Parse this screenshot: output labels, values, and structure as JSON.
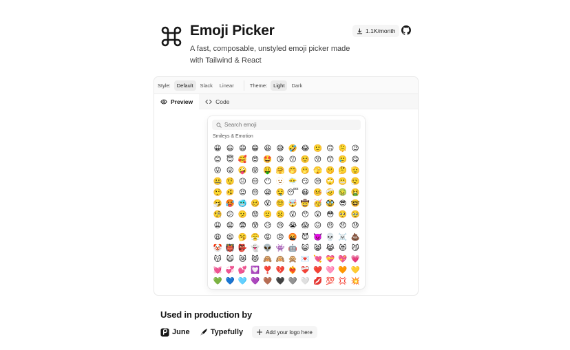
{
  "header": {
    "title": "Emoji Picker",
    "subtitle": "A fast, composable, unstyled emoji picker made with Tailwind & React",
    "downloads": "1.1K/month"
  },
  "toolbar": {
    "style_label": "Style:",
    "style_options": [
      "Default",
      "Slack",
      "Linear"
    ],
    "style_selected": "Default",
    "theme_label": "Theme:",
    "theme_options": [
      "Light",
      "Dark"
    ],
    "theme_selected": "Light"
  },
  "tabs": [
    {
      "label": "Preview",
      "icon": "eye-icon",
      "active": true
    },
    {
      "label": "Code",
      "icon": "code-icon",
      "active": false
    }
  ],
  "picker": {
    "search_placeholder": "Search emoji",
    "category": "Smileys & Emotion",
    "emojis": [
      "😀",
      "😃",
      "😄",
      "😁",
      "😆",
      "😅",
      "🤣",
      "😂",
      "🙂",
      "🙃",
      "🫠",
      "😉",
      "😊",
      "😇",
      "🥰",
      "😍",
      "🤩",
      "😘",
      "😗",
      "☺️",
      "😚",
      "😙",
      "🥲",
      "😋",
      "😛",
      "😜",
      "🤪",
      "😝",
      "🤑",
      "🤗",
      "🤭",
      "🫢",
      "🫣",
      "🤫",
      "🤔",
      "🫡",
      "🤐",
      "🤨",
      "😐",
      "😑",
      "😶",
      "🫥",
      "😶‍🌫️",
      "😏",
      "😒",
      "🙄",
      "😬",
      "😮‍💨",
      "🤥",
      "🫨",
      "😌",
      "😔",
      "😪",
      "🤤",
      "😴",
      "😷",
      "🤒",
      "🤕",
      "🤢",
      "🤮",
      "🤧",
      "🥵",
      "🥶",
      "🥴",
      "😵",
      "😵‍💫",
      "🤯",
      "🤠",
      "🥳",
      "🥸",
      "😎",
      "🤓",
      "🧐",
      "😕",
      "🫤",
      "😟",
      "🙁",
      "☹️",
      "😮",
      "😯",
      "😲",
      "😳",
      "🥺",
      "🥹",
      "😦",
      "😧",
      "😨",
      "😰",
      "😥",
      "😢",
      "😭",
      "😱",
      "😖",
      "😣",
      "😞",
      "😓",
      "😩",
      "😫",
      "🥱",
      "😤",
      "😡",
      "😠",
      "🤬",
      "😈",
      "👿",
      "💀",
      "☠️",
      "💩",
      "🤡",
      "👹",
      "👺",
      "👻",
      "👽",
      "👾",
      "🤖",
      "😺",
      "😸",
      "😹",
      "😻",
      "😼",
      "😽",
      "🙀",
      "😿",
      "😾",
      "🙈",
      "🙉",
      "🙊",
      "💌",
      "💘",
      "💝",
      "💖",
      "💗",
      "💓",
      "💞",
      "💕",
      "💟",
      "❣️",
      "💔",
      "❤️‍🔥",
      "❤️‍🩹",
      "❤️",
      "🩷",
      "🧡",
      "💛",
      "💚",
      "💙",
      "🩵",
      "💜",
      "🤎",
      "🖤",
      "🩶",
      "🤍",
      "💋",
      "💯",
      "💢",
      "💥"
    ]
  },
  "used_in": {
    "heading": "Used in production by",
    "brands": [
      "June",
      "Typefully"
    ],
    "add_label": "Add your logo here"
  }
}
